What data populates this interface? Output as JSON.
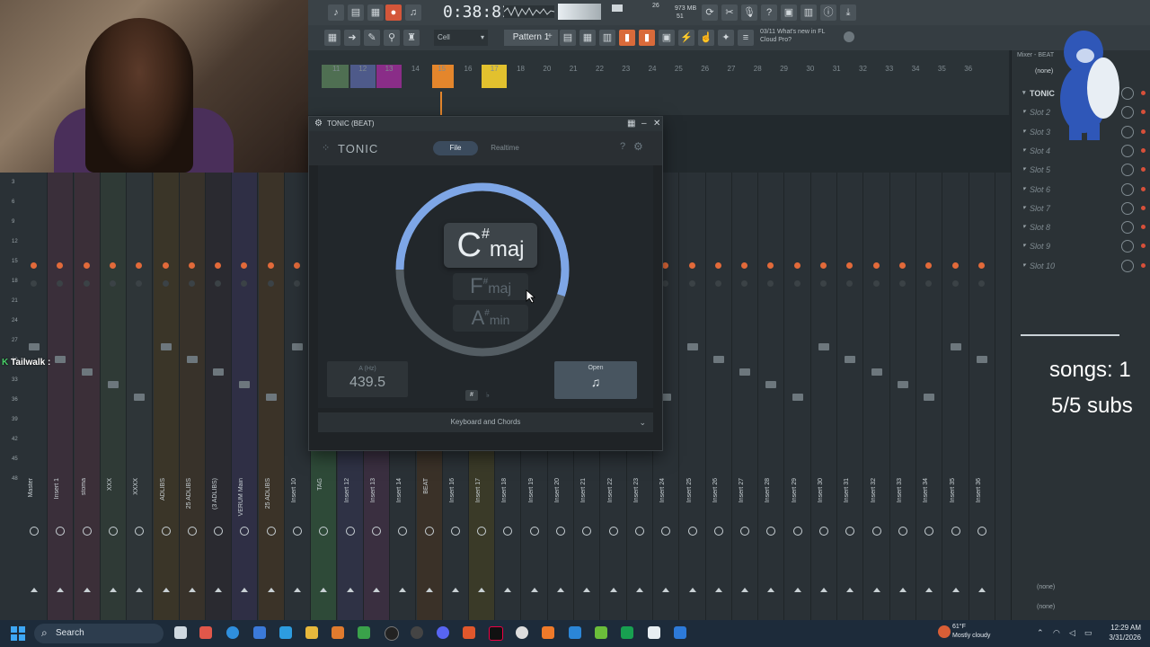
{
  "toolbar": {
    "time": "0:38:81",
    "cpu_ram": "973 MB",
    "cpu_num1": "26",
    "cpu_num2": "51",
    "pattern_label": "Pattern 1",
    "snap_label": "Cell",
    "news_line1": "03/11  What's new in FL",
    "news_line2": "Cloud Pro?"
  },
  "playlist": {
    "track_numbers": [
      "11",
      "12",
      "13",
      "14",
      "15",
      "16",
      "17",
      "18",
      "20",
      "21",
      "22",
      "23",
      "24",
      "25",
      "26",
      "27",
      "28",
      "29",
      "30",
      "31",
      "32",
      "33",
      "34",
      "35",
      "36"
    ]
  },
  "plugin": {
    "window_title": "TONIC (BEAT)",
    "logo": "TONIC",
    "tabs": [
      {
        "label": "File"
      },
      {
        "label": "Realtime"
      }
    ],
    "key_main": {
      "root": "C",
      "accidental": "#",
      "quality": "maj"
    },
    "key_2": {
      "root": "F",
      "accidental": "#",
      "quality": "maj"
    },
    "key_3": {
      "root": "A",
      "accidental": "#",
      "quality": "min"
    },
    "freq_label": "A (Hz)",
    "freq_value": "439.5",
    "sharp_label": "#",
    "flat_label": "♭",
    "open_label": "Open",
    "keyboard_chords": "Keyboard and Chords",
    "ring_fill": 0.55
  },
  "mixer": {
    "strips": [
      "Master",
      "Insert 1",
      "stoma",
      "XXX",
      "XXXX",
      "ADLIBS",
      "25 ADLIBS",
      "(3 ADLIBS)",
      "VERUM Main",
      "25 ADLIBS",
      "Insert 10",
      "TAG",
      "Insert 12",
      "Insert 13",
      "Insert 14",
      "BEAT",
      "Insert 16",
      "Insert 17",
      "Insert 18",
      "Insert 19",
      "Insert 20",
      "Insert 21",
      "Insert 22",
      "Insert 23",
      "Insert 24",
      "Insert 25",
      "Insert 26",
      "Insert 27",
      "Insert 28",
      "Insert 29",
      "Insert 30",
      "Insert 31",
      "Insert 32",
      "Insert 33",
      "Insert 34",
      "Insert 35",
      "Insert 36"
    ],
    "left_scale": [
      "3",
      "6",
      "9",
      "12",
      "15",
      "18",
      "21",
      "24",
      "27",
      "30",
      "33",
      "36",
      "39",
      "42",
      "45",
      "48"
    ]
  },
  "right_panel": {
    "header": "Mixer - BEAT",
    "none_top": "(none)",
    "slots": [
      "TONIC",
      "Slot 2",
      "Slot 3",
      "Slot 4",
      "Slot 5",
      "Slot 6",
      "Slot 7",
      "Slot 8",
      "Slot 9",
      "Slot 10"
    ],
    "none_bottom_1": "(none)",
    "none_bottom_2": "(none)"
  },
  "overlay": {
    "chat_user": "Tailwalk :",
    "songs": "songs: 1",
    "subs": "5/5 subs"
  },
  "taskbar": {
    "search_placeholder": "Search",
    "weather_temp": "61°F",
    "weather_desc": "Mostly cloudy",
    "clock_time": "12:29 AM",
    "clock_date": "3/31/2026"
  }
}
